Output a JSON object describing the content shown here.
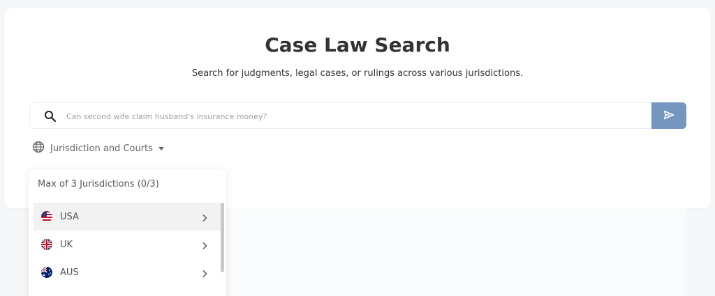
{
  "header": {
    "title": "Case Law Search",
    "subtitle": "Search for judgments, legal cases, or rulings across various jurisdictions."
  },
  "search": {
    "placeholder": "Can second wife claim husband's insurance money?",
    "value": ""
  },
  "filters": {
    "jurisdiction_label": "Jurisdiction and Courts"
  },
  "dropdown": {
    "heading": "Max of 3 Jurisdictions (0/3)",
    "items": [
      {
        "label": "USA",
        "flag": "us-flag-icon"
      },
      {
        "label": "UK",
        "flag": "uk-flag-icon"
      },
      {
        "label": "AUS",
        "flag": "aus-flag-icon"
      }
    ]
  },
  "icons": {
    "search": "search-icon",
    "send": "send-icon",
    "globe": "globe-icon",
    "chevron": "chevron-right-icon"
  },
  "colors": {
    "accent": "#7596bf",
    "title": "#333333",
    "active_row": "#f2f2f2"
  }
}
